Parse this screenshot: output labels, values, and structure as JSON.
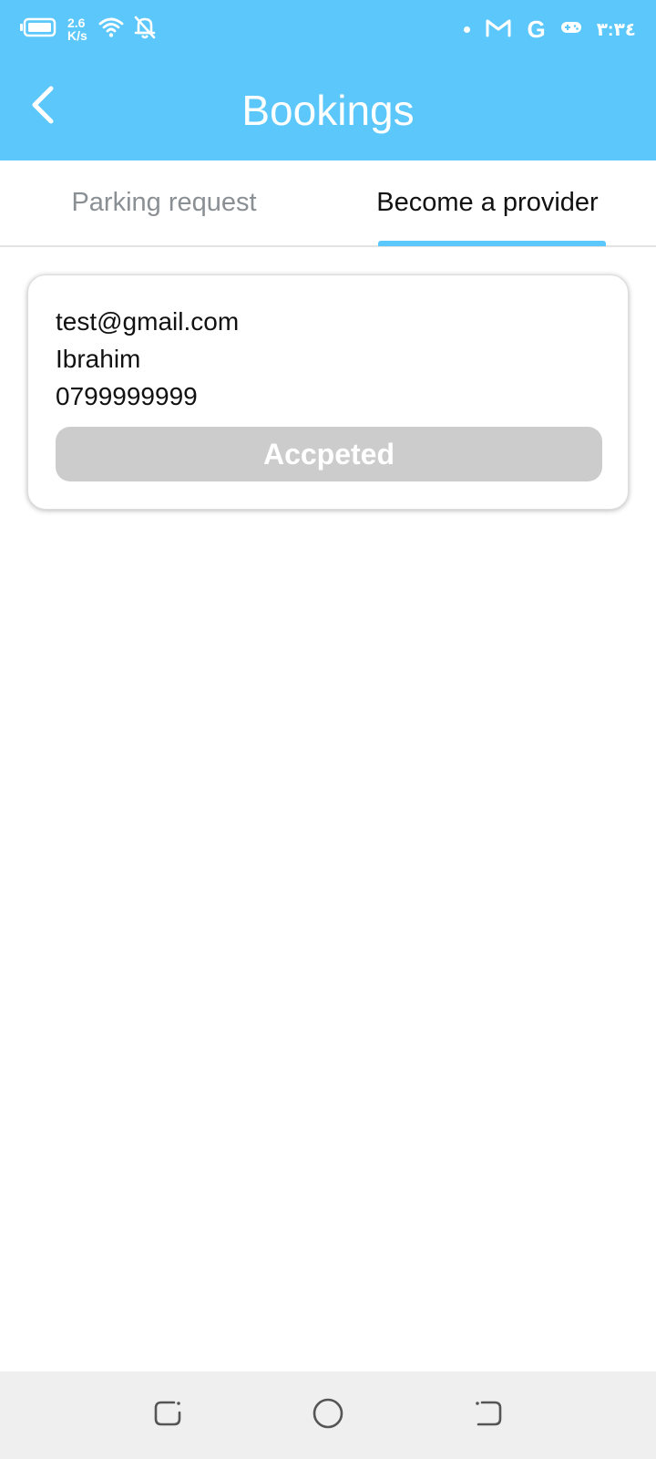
{
  "status_bar": {
    "speed_value": "2.6",
    "speed_unit": "K/s",
    "time": "٣:٣٤",
    "icons": [
      "battery-icon",
      "wifi-icon",
      "notifications-off-icon",
      "dot-icon",
      "gmail-icon",
      "google-icon",
      "game-controller-icon"
    ]
  },
  "app_bar": {
    "title": "Bookings",
    "back_icon": "chevron-left-icon",
    "background": "#5BC7FA"
  },
  "tabs": [
    {
      "label": "Parking request",
      "selected": false
    },
    {
      "label": "Become a provider",
      "selected": true
    }
  ],
  "card": {
    "email": "test@gmail.com",
    "name": "Ibrahim",
    "phone": "0799999999",
    "status_label": "Accpeted",
    "status_color": "#CCCCCC"
  },
  "colors": {
    "accent": "#5BC7FA",
    "text_dark": "#111111",
    "text_muted": "#8A8F94",
    "nav_background": "#EFEFEF"
  }
}
